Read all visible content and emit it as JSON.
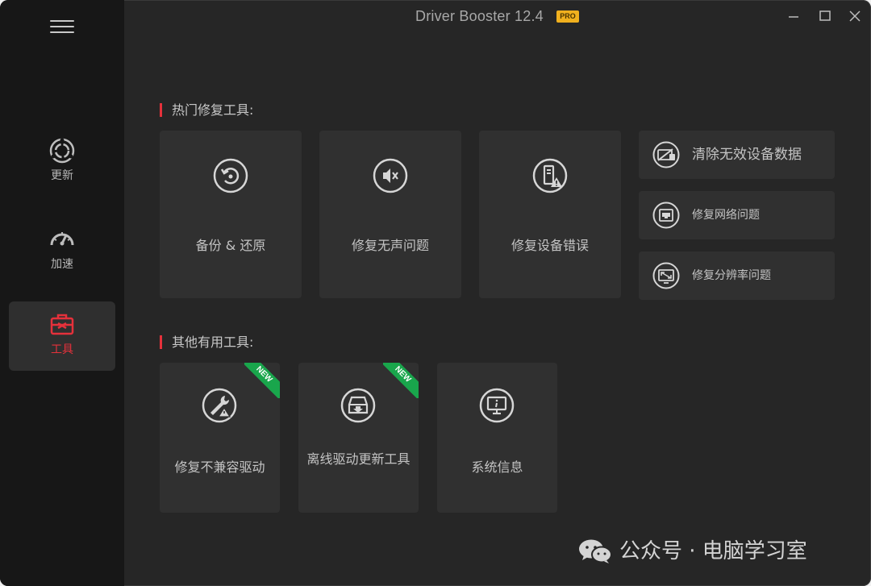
{
  "app": {
    "title": "Driver Booster 12.4",
    "badge": "PRO"
  },
  "colors": {
    "accent": "#e5313b",
    "new_ribbon": "#19a64c",
    "pro_badge": "#f0b01e"
  },
  "window_controls": [
    "minimize-icon",
    "maximize-icon",
    "close-icon"
  ],
  "sidebar": {
    "menu_icon": "hamburger-icon",
    "items": [
      {
        "label": "更新",
        "icon": "refresh-icon",
        "active": false
      },
      {
        "label": "加速",
        "icon": "speedometer-icon",
        "active": false
      },
      {
        "label": "工具",
        "icon": "toolbox-icon",
        "active": true
      }
    ]
  },
  "hot_tools": {
    "title": "热门修复工具:",
    "cards": [
      {
        "label": "备份 & 还原",
        "icon": "backup-restore-icon"
      },
      {
        "label": "修复无声问题",
        "icon": "mute-speaker-icon"
      },
      {
        "label": "修复设备错误",
        "icon": "device-warning-icon"
      }
    ],
    "side_cards": [
      {
        "label": "清除无效设备数据",
        "icon": "device-clean-icon"
      },
      {
        "label": "修复网络问题",
        "icon": "network-port-icon"
      },
      {
        "label": "修复分辨率问题",
        "icon": "resolution-icon"
      }
    ]
  },
  "other_tools": {
    "title": "其他有用工具:",
    "cards": [
      {
        "label": "修复不兼容驱动",
        "icon": "wrench-warning-icon",
        "badge": "NEW"
      },
      {
        "label": "离线驱动更新工具",
        "icon": "offline-download-icon",
        "badge": "NEW"
      },
      {
        "label": "系统信息",
        "icon": "monitor-info-icon"
      }
    ]
  },
  "watermark": {
    "text": "公众号 · 电脑学习室",
    "icon": "wechat-icon"
  }
}
